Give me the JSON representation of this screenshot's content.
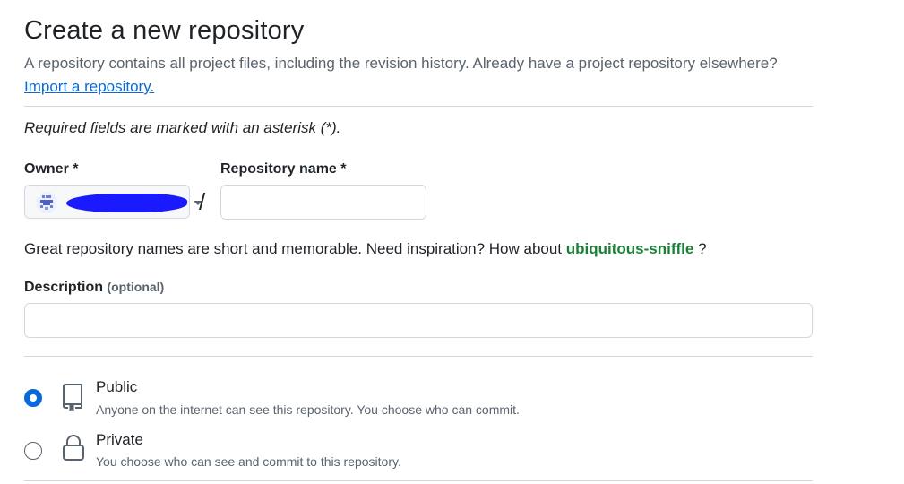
{
  "header": {
    "title": "Create a new repository",
    "subtitle": "A repository contains all project files, including the revision history. Already have a project repository elsewhere?",
    "import_link": "Import a repository."
  },
  "form": {
    "required_note": "Required fields are marked with an asterisk (*).",
    "owner": {
      "label": "Owner *",
      "value": "",
      "avatar_icon": "identicon-avatar"
    },
    "separator": "/",
    "repo_name": {
      "label": "Repository name *",
      "value": "",
      "placeholder": ""
    },
    "name_hint": {
      "prefix": "Great repository names are short and memorable. Need inspiration? How about",
      "suggestion": "ubiquitous-sniffle",
      "suffix": "?"
    },
    "description": {
      "label": "Description",
      "optional": "(optional)",
      "value": "",
      "placeholder": ""
    },
    "visibility": {
      "selected": "public",
      "options": [
        {
          "id": "public",
          "title": "Public",
          "description": "Anyone on the internet can see this repository. You choose who can commit.",
          "icon": "repo-icon"
        },
        {
          "id": "private",
          "title": "Private",
          "description": "You choose who can see and commit to this repository.",
          "icon": "lock-icon"
        }
      ]
    }
  },
  "colors": {
    "accent": "#0969da",
    "suggestion": "#1a7f37",
    "muted_text": "#59636e",
    "border": "#d1d9e0"
  }
}
